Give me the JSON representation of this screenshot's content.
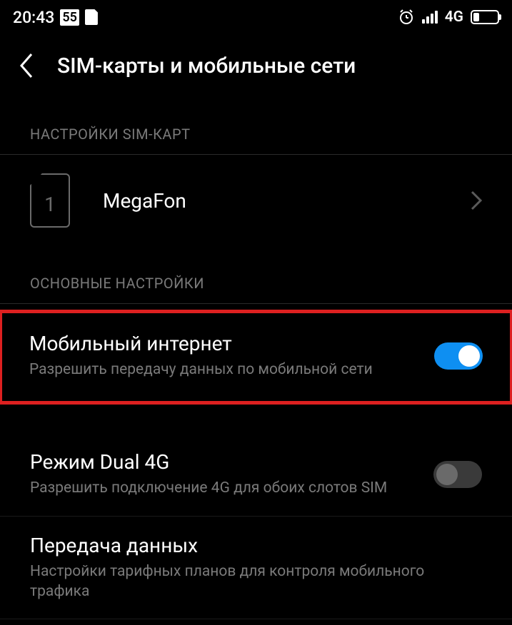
{
  "status_bar": {
    "time": "20:43",
    "notification_badge": "55",
    "network_type": "4G"
  },
  "header": {
    "title": "SIM-карты и мобильные сети"
  },
  "sections": {
    "sim_settings": {
      "header": "НАСТРОЙКИ SIM-КАРТ",
      "sim1": {
        "slot_number": "1",
        "carrier": "MegaFon"
      }
    },
    "main_settings": {
      "header": "ОСНОВНЫЕ НАСТРОЙКИ",
      "mobile_data": {
        "title": "Мобильный интернет",
        "subtitle": "Разрешить передачу данных по мобильной сети",
        "enabled": true
      },
      "dual_4g": {
        "title": "Режим Dual 4G",
        "subtitle": "Разрешить подключение 4G для обоих слотов SIM",
        "enabled": false
      },
      "data_transfer": {
        "title": "Передача данных",
        "subtitle": "Настройки тарифных планов для контроля мобильного трафика"
      }
    }
  }
}
